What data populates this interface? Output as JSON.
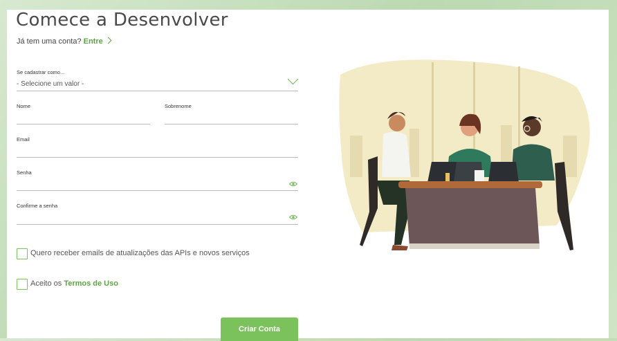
{
  "header": {
    "title": "Comece a Desenvolver",
    "login_prompt": "Já tem uma conta?",
    "login_link": "Entre"
  },
  "form": {
    "register_as_label": "Se cadastrar como...",
    "register_as_value": "- Selecione um valor -",
    "first_name_label": "Nome",
    "last_name_label": "Sobrenome",
    "email_label": "Email",
    "password_label": "Senha",
    "confirm_password_label": "Confirme a senha",
    "newsletter_label": "Quero receber emails de atualizações das APIs e novos serviços",
    "terms_prefix": "Aceito os",
    "terms_link": "Termos de Uso",
    "submit_label": "Criar Conta"
  },
  "icons": {
    "dropdown": "chevron-down-icon",
    "password_toggle": "eye-icon"
  },
  "colors": {
    "accent": "#7cc25c",
    "link": "#5aa63f",
    "title": "#4a4a4a",
    "background_frame": "#c8e0bd"
  }
}
